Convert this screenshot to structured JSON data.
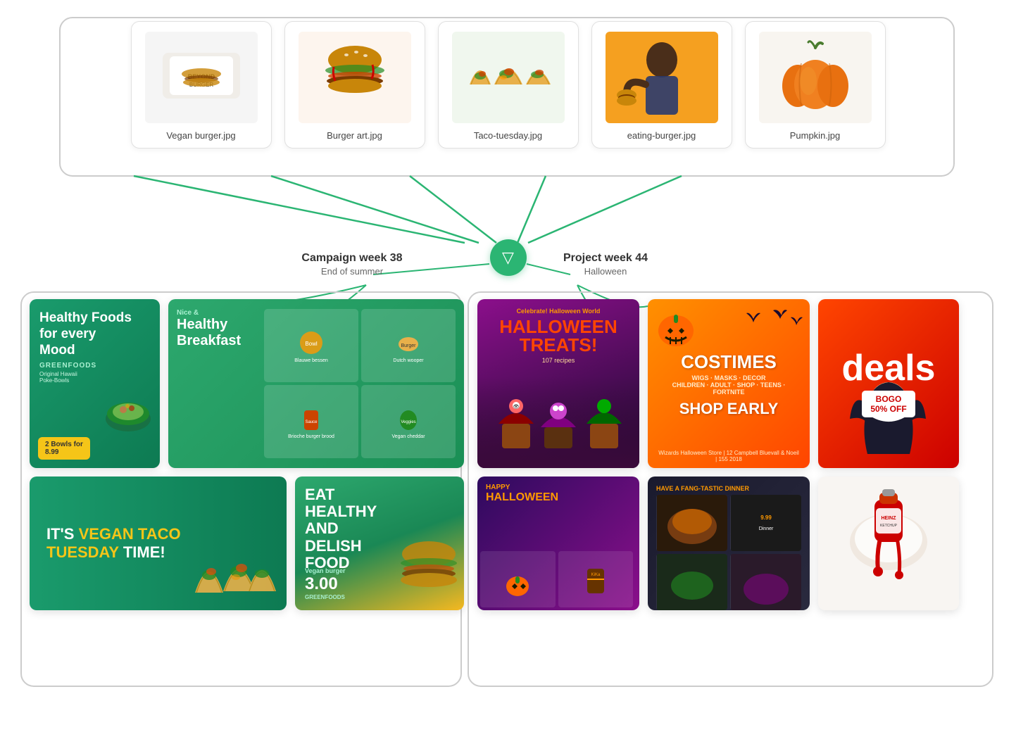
{
  "assets": [
    {
      "id": "vegan-burger",
      "label": "Vegan burger.jpg",
      "color": "#f0f0f0",
      "emoji": "🍔"
    },
    {
      "id": "burger-art",
      "label": "Burger art.jpg",
      "color": "#f5f0ea",
      "emoji": "🍔"
    },
    {
      "id": "taco-tuesday",
      "label": "Taco-tuesday.jpg",
      "color": "#f0f5ea",
      "emoji": "🌮"
    },
    {
      "id": "eating-burger",
      "label": "eating-burger.jpg",
      "color": "#f5a020",
      "emoji": "📸"
    },
    {
      "id": "pumpkin",
      "label": "Pumpkin.jpg",
      "color": "#f8f0e8",
      "emoji": "🎃"
    }
  ],
  "campaigns": [
    {
      "id": "campaign-left",
      "title": "Campaign week 38",
      "subtitle": "End of summer"
    },
    {
      "id": "campaign-right",
      "title": "Project week 44",
      "subtitle": "Halloween"
    }
  ],
  "hub": {
    "icon": "▽"
  },
  "left_cards": {
    "row1": [
      {
        "id": "healthy-foods",
        "type": "healthy",
        "headline": "Healthy Foods for every Mood",
        "brand": "GREENFOODS",
        "sub": "Original Hawaii Poke-Bowls",
        "price": "2 Bowls for 8.99"
      },
      {
        "id": "nice-healthy-breakfast",
        "type": "breakfast",
        "headline": "Nice & Healthy Breakfast"
      }
    ],
    "row2": [
      {
        "id": "vegan-taco",
        "type": "taco",
        "line1": "IT'S VEGAN TACO",
        "line2": "TUESDAY TIME!"
      },
      {
        "id": "eat-healthy",
        "type": "burger-ad",
        "text": "EAT HEALTHY AND DELISH FOOD",
        "sub": "Vegan burger",
        "price": "3.00"
      }
    ]
  },
  "right_cards": {
    "row1": [
      {
        "id": "halloween-mag",
        "type": "halloween-mag",
        "celebrate": "Celebrate!",
        "big": "HALLOWEEN TREATS!",
        "sub": "107 recipes"
      },
      {
        "id": "costumes-shop",
        "type": "halloween-shop",
        "headline": "COSTIMES",
        "sub": "WIGS · MASKS · DECOR",
        "cta": "SHOP EARLY"
      },
      {
        "id": "deals",
        "type": "deals",
        "label": "deals",
        "bogo": "BOGO 50% OFF"
      }
    ],
    "row2": [
      {
        "id": "hw-flyer",
        "type": "hw-flyer",
        "text": "HAPPY HALLOWEEN"
      },
      {
        "id": "fang-dinner",
        "type": "dinner",
        "text": "HAVE A FANG-TASTIC DINNER"
      },
      {
        "id": "ketchup",
        "type": "ketchup",
        "text": "🍅"
      }
    ]
  }
}
